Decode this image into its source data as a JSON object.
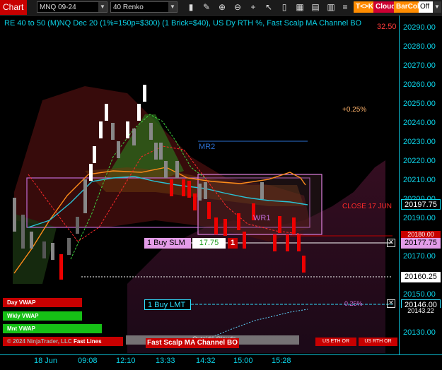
{
  "toolbar": {
    "tab_label": "Chart",
    "instrument": "MNQ 09-24",
    "bar_type": "40 Renko",
    "toggles": {
      "tk": "T<>K",
      "cloud": "Cloud",
      "barcol": "BarCol",
      "off": "Off"
    },
    "icons": [
      "draw-icon",
      "zoom-icon",
      "zoom-out-icon",
      "crosshair-icon",
      "cursor-icon",
      "indicator-icon",
      "grid-icon",
      "properties-icon",
      "layout-icon"
    ]
  },
  "chart": {
    "title": "RE 40 to 50 (M)NQ Dec 20 (1%=150p=$300) (1 Brick=$40), US Dy RTH %, Fast Scalp MA Channel BO",
    "title_value": "32.50",
    "colors": {
      "axis": "#0bd3e8",
      "bull": "#ffffff",
      "bear": "#e00000",
      "ma_fast": "#ff8c1a",
      "ma_slow": "#2ac3d6",
      "cloud_green": "#2e6b1c"
    },
    "annotations": {
      "pct_top": "+0.25%",
      "pct_bottom": "0.25%",
      "mr2": "MR2",
      "wr1": "WR1",
      "close_label": "CLOSE 17 JUN",
      "outside_clouds": "Outside Clouds",
      "copyright": "© 2024 NinjaTrader, LLC",
      "zone_label": "Fast Scalp MA Channel BO",
      "fast_lines": "Fast Lines"
    },
    "orders": {
      "buy_slm_label": "1 Buy SLM",
      "buy_slm_offset": "17.75",
      "buy_slm_qty": "1",
      "buy_lmt_label": "1 Buy LMT"
    },
    "vwap": {
      "day": "Day VWAP",
      "wkly": "Wkly VWAP",
      "mnt": "Mnt VWAP"
    },
    "session_labels": {
      "us_eth": "US ETH OR",
      "us_rth": "US RTH OR"
    }
  },
  "price_axis": {
    "ticks": [
      "20290.00",
      "20280.00",
      "20270.00",
      "20260.00",
      "20250.00",
      "20240.00",
      "20230.00",
      "20220.00",
      "20210.00",
      "20200.00",
      "20190.00",
      "20170.00",
      "20150.00",
      "20130.00"
    ],
    "tags": {
      "p197": "20197.75",
      "p184": "20180.00",
      "p177": "20177.75",
      "p160": "20160.25",
      "p146": "20146.00",
      "p143": "20143.22"
    }
  },
  "time_axis": {
    "ticks": [
      "18 Jun",
      "09:08",
      "12:10",
      "13:33",
      "14:32",
      "15:00",
      "15:28"
    ]
  }
}
